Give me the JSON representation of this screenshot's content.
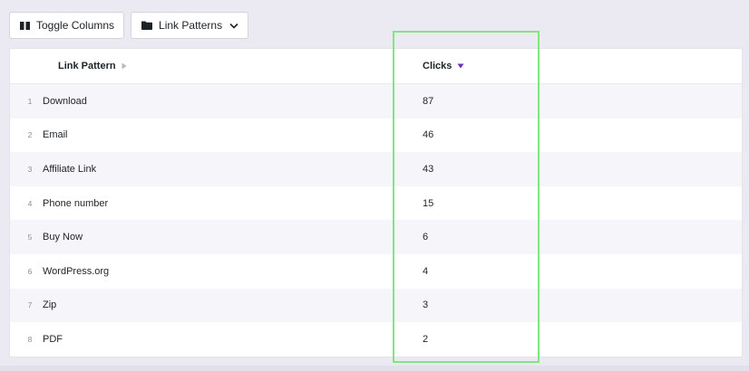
{
  "toolbar": {
    "toggle_columns_label": "Toggle Columns",
    "link_patterns_label": "Link Patterns"
  },
  "table": {
    "columns": [
      "Link Pattern",
      "Clicks"
    ],
    "rows": [
      {
        "index": "1",
        "pattern": "Download",
        "clicks": "87"
      },
      {
        "index": "2",
        "pattern": "Email",
        "clicks": "46"
      },
      {
        "index": "3",
        "pattern": "Affiliate Link",
        "clicks": "43"
      },
      {
        "index": "4",
        "pattern": "Phone number",
        "clicks": "15"
      },
      {
        "index": "5",
        "pattern": "Buy Now",
        "clicks": "6"
      },
      {
        "index": "6",
        "pattern": "WordPress.org",
        "clicks": "4"
      },
      {
        "index": "7",
        "pattern": "Zip",
        "clicks": "3"
      },
      {
        "index": "8",
        "pattern": "PDF",
        "clicks": "2"
      }
    ],
    "sorted_column": "Clicks",
    "sort_direction": "descending"
  },
  "colors": {
    "sort_arrow_active": "#6b2fb3",
    "sort_arrow_inactive": "#b8b5c2",
    "highlight_box": "#7ee87e",
    "background": "#ebe9f2"
  },
  "icons": {
    "toggle_columns": "columns-icon",
    "link_patterns": "folder-icon",
    "dropdown": "chevron-down-icon"
  }
}
